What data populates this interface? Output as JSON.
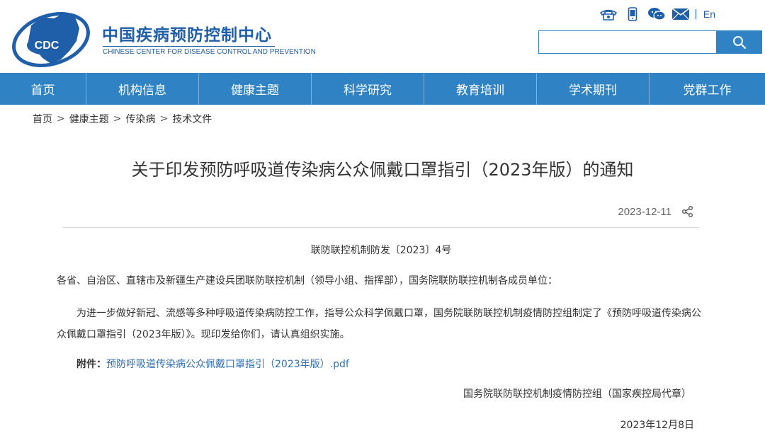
{
  "header": {
    "logo_text": "CDC",
    "title": "中国疾病预防控制中心",
    "subtitle": "CHINESE CENTER FOR DISEASE CONTROL AND PREVENTION",
    "icons": [
      "phone-icon",
      "mobile-icon",
      "wechat-icon",
      "mail-icon"
    ],
    "separator": "|",
    "lang": "En",
    "search": {
      "value": "",
      "placeholder": ""
    },
    "brand_color": "#2f83c5"
  },
  "nav": {
    "items": [
      {
        "label": "首页"
      },
      {
        "label": "机构信息"
      },
      {
        "label": "健康主题"
      },
      {
        "label": "科学研究"
      },
      {
        "label": "教育培训"
      },
      {
        "label": "学术期刊"
      },
      {
        "label": "党群工作"
      }
    ]
  },
  "breadcrumb": {
    "items": [
      "首页",
      "健康主题",
      "传染病",
      "技术文件"
    ],
    "separator": ">"
  },
  "article": {
    "title": "关于印发预防呼吸道传染病公众佩戴口罩指引（2023年版）的通知",
    "date": "2023-12-11",
    "doc_number": "联防联控机制防发〔2023〕4号",
    "recipients": "各省、自治区、直辖市及新疆生产建设兵团联防联控机制（领导小组、指挥部），国务院联防联控机制各成员单位：",
    "body": "为进一步做好新冠、流感等多种呼吸道传染病防控工作，指导公众科学佩戴口罩，国务院联防联控机制疫情防控组制定了《预防呼吸道传染病公众佩戴口罩指引（2023年版）》。现印发给你们，请认真组织实施。",
    "attachment_label": "附件：",
    "attachment_link": "预防呼吸道传染病公众佩戴口罩指引（2023年版）.pdf",
    "signer": "国务院联防联控机制疫情防控组（国家疾控局代章）",
    "sign_date": "2023年12月8日"
  }
}
